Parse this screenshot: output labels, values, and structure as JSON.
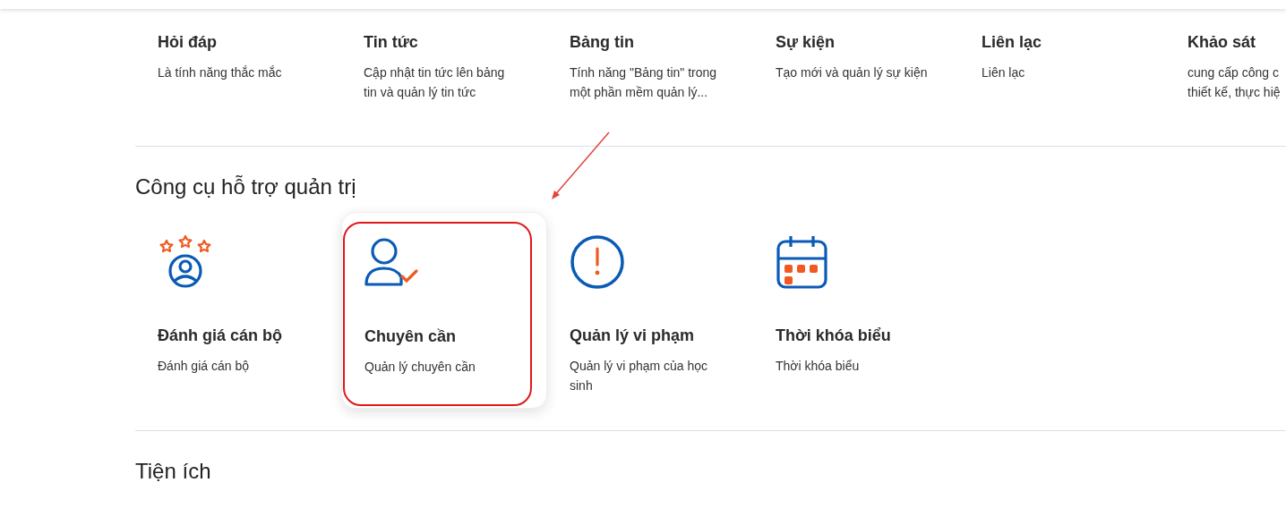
{
  "features": [
    {
      "title": "Hỏi đáp",
      "description_lines": [
        "Là tính năng thắc mắc"
      ]
    },
    {
      "title": "Tin tức",
      "description_lines": [
        "Cập nhật tin tức lên bảng",
        "tin và quản lý tin tức"
      ]
    },
    {
      "title": "Bảng tin",
      "description_lines": [
        "Tính năng \"Bảng tin\" trong",
        "một phần mềm quản lý..."
      ]
    },
    {
      "title": "Sự kiện",
      "description_lines": [
        "Tạo mới và quản lý sự kiện"
      ]
    },
    {
      "title": "Liên lạc",
      "description_lines": [
        "Liên lạc"
      ]
    },
    {
      "title": "Khảo sát",
      "description_lines": [
        "cung cấp công c",
        "thiết kế, thực hiệ"
      ]
    }
  ],
  "admin_tools": {
    "heading": "Công cụ hỗ trợ quản trị",
    "items": [
      {
        "kind": "rating",
        "title": "Đánh giá cán bộ",
        "description_lines": [
          "Đánh giá cán bộ"
        ],
        "highlighted": false
      },
      {
        "kind": "attendance",
        "title": "Chuyên cần",
        "description_lines": [
          "Quản lý chuyên cần"
        ],
        "highlighted": true
      },
      {
        "kind": "violation",
        "title": "Quản lý vi phạm",
        "description_lines": [
          "Quản lý vi phạm của học",
          "sinh"
        ],
        "highlighted": false
      },
      {
        "kind": "timetable",
        "title": "Thời khóa biểu",
        "description_lines": [
          "Thời khóa biểu"
        ],
        "highlighted": false
      }
    ]
  },
  "utilities": {
    "heading": "Tiện ích"
  }
}
